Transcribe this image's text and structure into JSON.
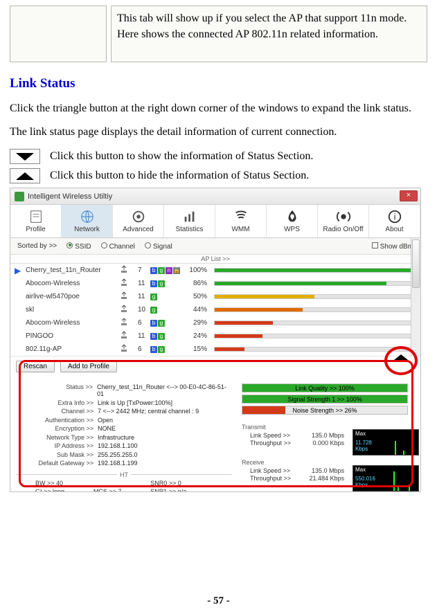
{
  "top_box": {
    "description": "This tab will show up if you select the AP that support 11n mode. Here shows the connected AP 802.11n related information."
  },
  "section": {
    "heading": "Link Status",
    "body": "Click the triangle button at the right down corner of the windows to expand the link status. The link status page displays the detail information of current connection.",
    "tri_down_desc": "Click this button to show the information of Status Section.",
    "tri_up_desc": "Click this button to hide the information of Status Section."
  },
  "screenshot": {
    "window_title": "Intelligent Wireless Utiltiy",
    "close_label": "×",
    "tabs": [
      "Profile",
      "Network",
      "Advanced",
      "Statistics",
      "WMM",
      "WPS",
      "Radio On/Off",
      "About"
    ],
    "active_tab_index": 1,
    "sort": {
      "label": "Sorted by >>",
      "opts": [
        "SSID",
        "Channel",
        "Signal"
      ],
      "checked_index": 0,
      "show_dbm": "Show dBm"
    },
    "aplist_label": "AP List >>",
    "ap_rows": [
      {
        "selected": true,
        "ssid": "Cherry_test_11n_Router",
        "ch": "7",
        "badges": [
          "b",
          "g",
          "n",
          "s"
        ],
        "pct": "100%",
        "fill": 100,
        "color": "#2aa82a"
      },
      {
        "selected": false,
        "ssid": "Abocom-Wireless",
        "ch": "11",
        "badges": [
          "b",
          "g"
        ],
        "pct": "86%",
        "fill": 86,
        "color": "#2aa82a"
      },
      {
        "selected": false,
        "ssid": "airlive-wl5470poe",
        "ch": "11",
        "badges": [
          "g"
        ],
        "pct": "50%",
        "fill": 50,
        "color": "#e0b000"
      },
      {
        "selected": false,
        "ssid": "skl",
        "ch": "10",
        "badges": [
          "g"
        ],
        "pct": "44%",
        "fill": 44,
        "color": "#e06a00"
      },
      {
        "selected": false,
        "ssid": "Abocom-Wireless",
        "ch": "6",
        "badges": [
          "b",
          "g"
        ],
        "pct": "29%",
        "fill": 29,
        "color": "#d43a1a"
      },
      {
        "selected": false,
        "ssid": "PINGOO",
        "ch": "11",
        "badges": [
          "b",
          "g"
        ],
        "pct": "24%",
        "fill": 24,
        "color": "#d43a1a"
      },
      {
        "selected": false,
        "ssid": "802.11g-AP",
        "ch": "6",
        "badges": [
          "b",
          "g"
        ],
        "pct": "15%",
        "fill": 15,
        "color": "#d43a1a"
      }
    ],
    "buttons": {
      "rescan": "Rescan",
      "add": "Add to Profile"
    },
    "status": {
      "rows": [
        {
          "label": "Status >>",
          "value": "Cherry_test_11n_Router <--> 00-E0-4C-86-51-01"
        },
        {
          "label": "Extra Info >>",
          "value": "Link is Up [TxPower:100%]"
        },
        {
          "label": "Channel >>",
          "value": "7 <--> 2442 MHz; central channel : 9"
        },
        {
          "label": "Authentication >>",
          "value": "Open"
        },
        {
          "label": "Encryption >>",
          "value": "NONE"
        },
        {
          "label": "Network Type >>",
          "value": "Infrastructure"
        },
        {
          "label": "IP Address >>",
          "value": "192.168.1.100"
        },
        {
          "label": "Sub Mask >>",
          "value": "255.255.255.0"
        },
        {
          "label": "Default Gateway >>",
          "value": "192.168.1.199"
        }
      ],
      "ht_label": "HT",
      "ht": {
        "bw_label": "BW >>",
        "bw_val": "40",
        "snr0_label": "SNR0 >>",
        "snr0_val": "0",
        "gi_label": "GI >>",
        "gi_val": "long",
        "mcs_label": "MCS >>",
        "mcs_val": "7",
        "snr1_label": "SNR1 >>",
        "snr1_val": "n/a"
      }
    },
    "quality": {
      "link_label": "Link Quality >> 100%",
      "link_fill": 100,
      "sig_label": "Signal Strength 1 >> 100%",
      "sig_fill": 100,
      "noise_label": "Noise Strength >> 26%",
      "noise_fill": 26
    },
    "transmit": {
      "title": "Transmit",
      "speed_label": "Link Speed >>",
      "speed_val": "135.0 Mbps",
      "thru_label": "Throughput >>",
      "thru_val": "0.000 Kbps",
      "graph_max": "Max",
      "graph_val": "11.728",
      "graph_unit": "Kbps"
    },
    "receive": {
      "title": "Receive",
      "speed_label": "Link Speed >>",
      "speed_val": "135.0 Mbps",
      "thru_label": "Throughput >>",
      "thru_val": "21.484 Kbps",
      "graph_max": "Max",
      "graph_val": "550.016",
      "graph_unit": "Kbps"
    }
  },
  "page_number": "- 57 -"
}
